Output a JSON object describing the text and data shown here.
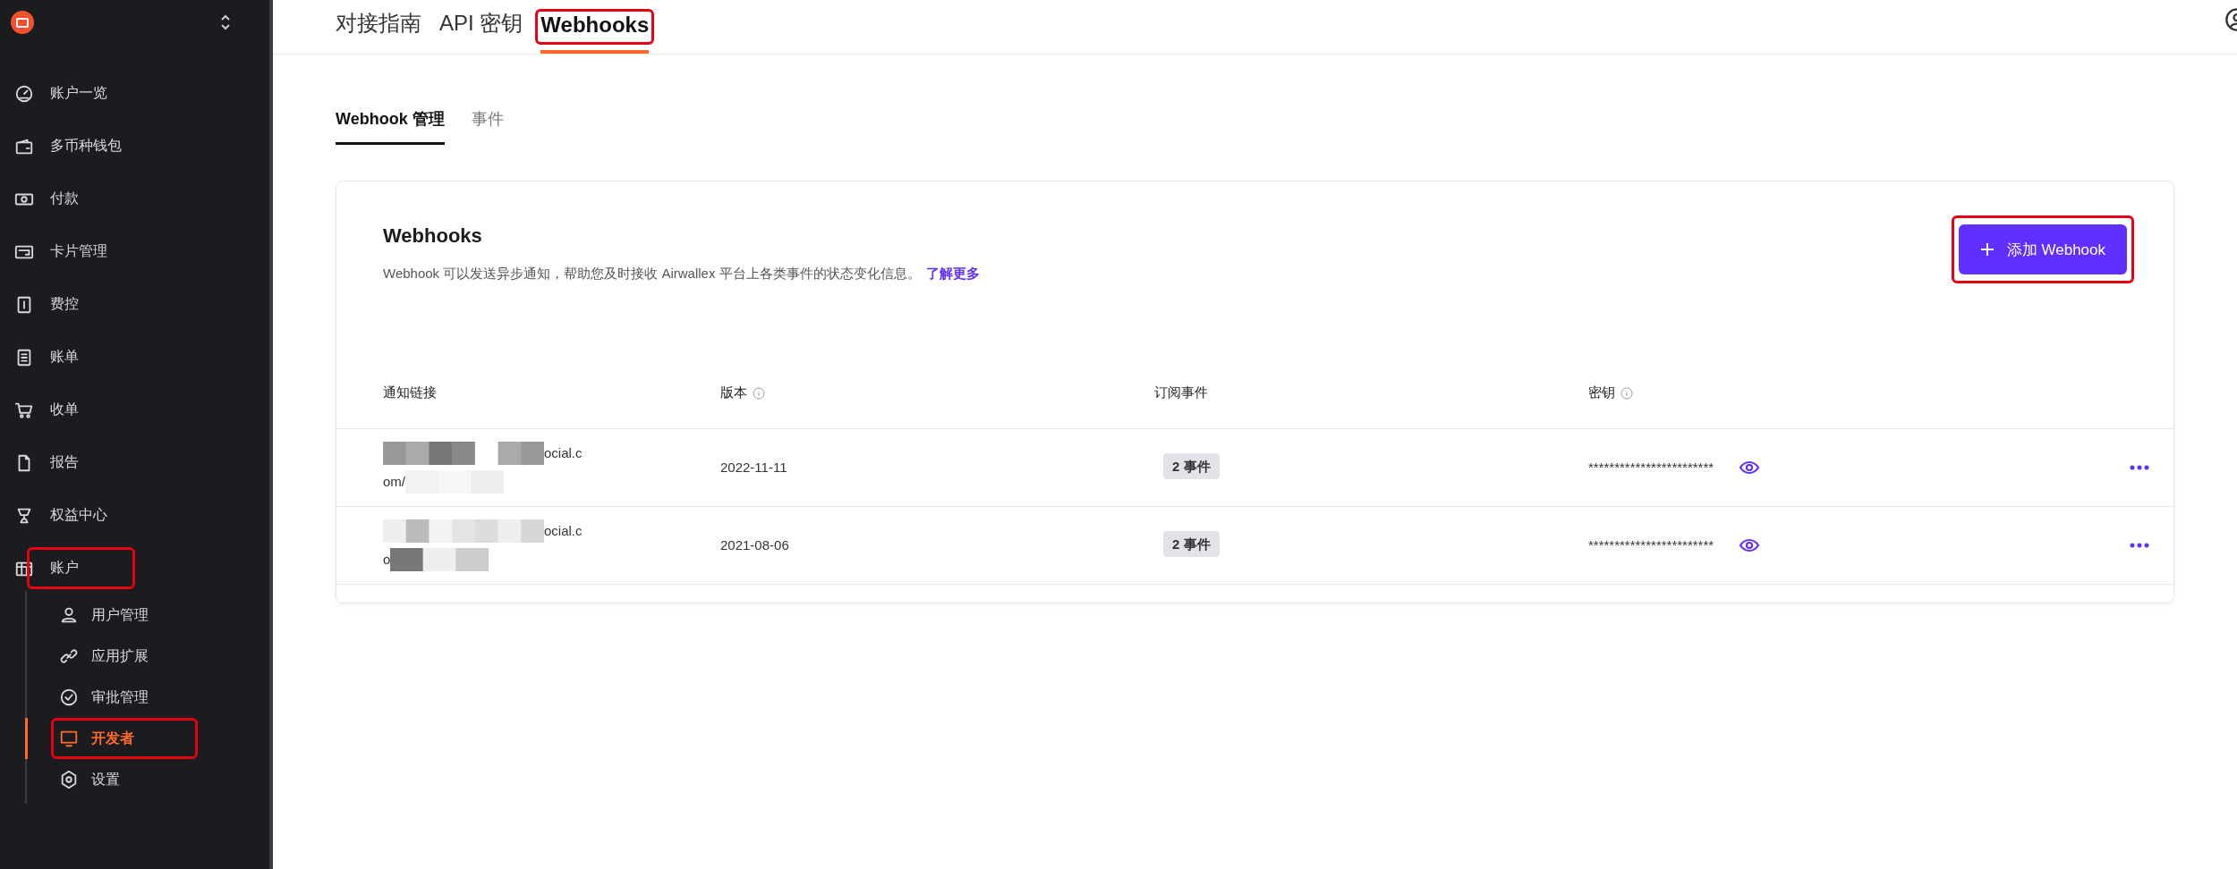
{
  "sidebar": {
    "items": [
      {
        "label": "账户一览",
        "selected": false,
        "highlighted": false
      },
      {
        "label": "多币种钱包",
        "selected": false,
        "highlighted": false
      },
      {
        "label": "付款",
        "selected": false,
        "highlighted": false
      },
      {
        "label": "卡片管理",
        "selected": false,
        "highlighted": false
      },
      {
        "label": "费控",
        "selected": false,
        "highlighted": false
      },
      {
        "label": "账单",
        "selected": false,
        "highlighted": false
      },
      {
        "label": "收单",
        "selected": false,
        "highlighted": false
      },
      {
        "label": "报告",
        "selected": false,
        "highlighted": false
      },
      {
        "label": "权益中心",
        "selected": false,
        "highlighted": false
      },
      {
        "label": "账户",
        "selected": false,
        "highlighted": true,
        "children": [
          {
            "label": "用户管理",
            "selected": false,
            "highlighted": false
          },
          {
            "label": "应用扩展",
            "selected": false,
            "highlighted": false
          },
          {
            "label": "审批管理",
            "selected": false,
            "highlighted": false
          },
          {
            "label": "开发者",
            "selected": true,
            "highlighted": true
          },
          {
            "label": "设置",
            "selected": false,
            "highlighted": false
          }
        ]
      }
    ]
  },
  "top_tabs": [
    {
      "label": "对接指南",
      "selected": false,
      "highlighted": false
    },
    {
      "label": "API 密钥",
      "selected": false,
      "highlighted": false
    },
    {
      "label": "Webhooks",
      "selected": true,
      "highlighted": true
    }
  ],
  "sub_tabs": [
    {
      "label": "Webhook 管理",
      "selected": true
    },
    {
      "label": "事件",
      "selected": false
    }
  ],
  "card": {
    "title": "Webhooks",
    "description": "Webhook 可以发送异步通知，帮助您及时接收 Airwallex 平台上各类事件的状态变化信息。",
    "link": "了解更多",
    "button": {
      "label": "添加 Webhook",
      "highlighted": true
    }
  },
  "table": {
    "columns": [
      {
        "label": "通知链接",
        "info": false
      },
      {
        "label": "版本",
        "info": true
      },
      {
        "label": "订阅事件",
        "info": false
      },
      {
        "label": "密钥",
        "info": true
      }
    ],
    "rows": [
      {
        "url_line1": "ocial.c",
        "url_line2": "om/",
        "version": "2022-11-11",
        "events": "2 事件",
        "secret": "************************"
      },
      {
        "url_line1": "ocial.c",
        "url_line2": "o",
        "version": "2021-08-06",
        "events": "2 事件",
        "secret": "************************"
      }
    ]
  }
}
